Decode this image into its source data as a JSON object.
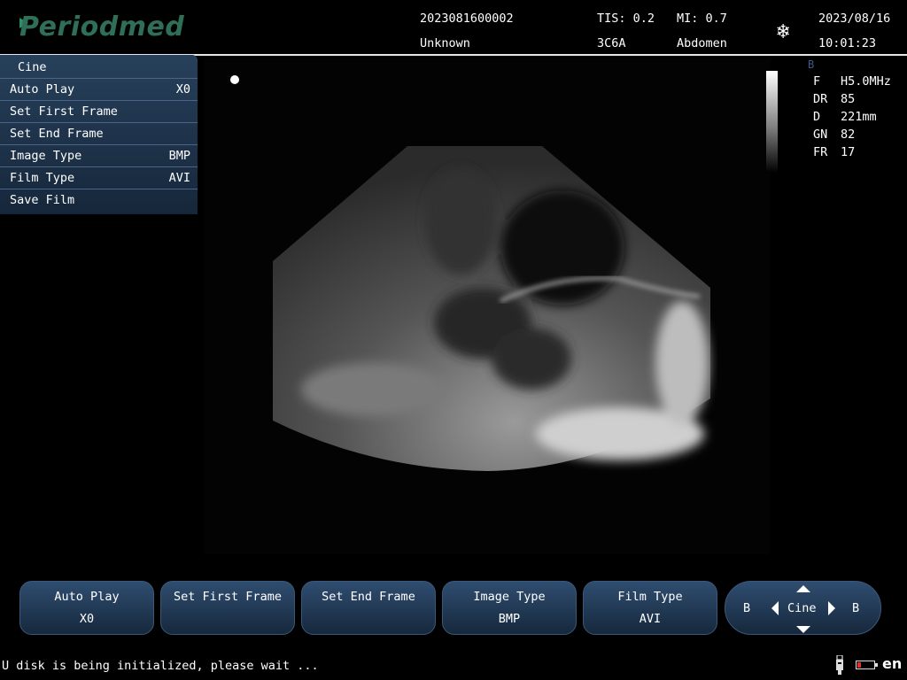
{
  "header": {
    "logo": "Periodmed",
    "patient_id": "2023081600002",
    "patient_name": "Unknown",
    "tis": "TIS: 0.2",
    "probe": "3C6A",
    "mi": "MI: 0.7",
    "exam": "Abdomen",
    "date": "2023/08/16",
    "time": "10:01:23"
  },
  "cine_menu": {
    "title": "Cine",
    "items": [
      {
        "label": "Auto Play",
        "value": "X0"
      },
      {
        "label": "Set First Frame",
        "value": ""
      },
      {
        "label": "Set End Frame",
        "value": ""
      },
      {
        "label": "Image Type",
        "value": "BMP"
      },
      {
        "label": "Film Type",
        "value": "AVI"
      },
      {
        "label": "Save Film",
        "value": ""
      }
    ]
  },
  "image_params": {
    "mode": "B",
    "rows": [
      {
        "key": "F",
        "value": "H5.0MHz"
      },
      {
        "key": "DR",
        "value": "85"
      },
      {
        "key": "D",
        "value": "221mm"
      },
      {
        "key": "GN",
        "value": "82"
      },
      {
        "key": "FR",
        "value": "17"
      }
    ]
  },
  "toolbar": {
    "buttons": [
      {
        "label": "Auto Play",
        "value": "X0"
      },
      {
        "label": "Set First Frame",
        "value": ""
      },
      {
        "label": "Set End Frame",
        "value": ""
      },
      {
        "label": "Image Type",
        "value": "BMP"
      },
      {
        "label": "Film Type",
        "value": "AVI"
      }
    ],
    "nav": {
      "left": "B",
      "center": "Cine",
      "right": "B"
    }
  },
  "status": {
    "message": "U disk is being initialized, please wait ...",
    "language": "en",
    "battery_color": "#e0302a"
  }
}
